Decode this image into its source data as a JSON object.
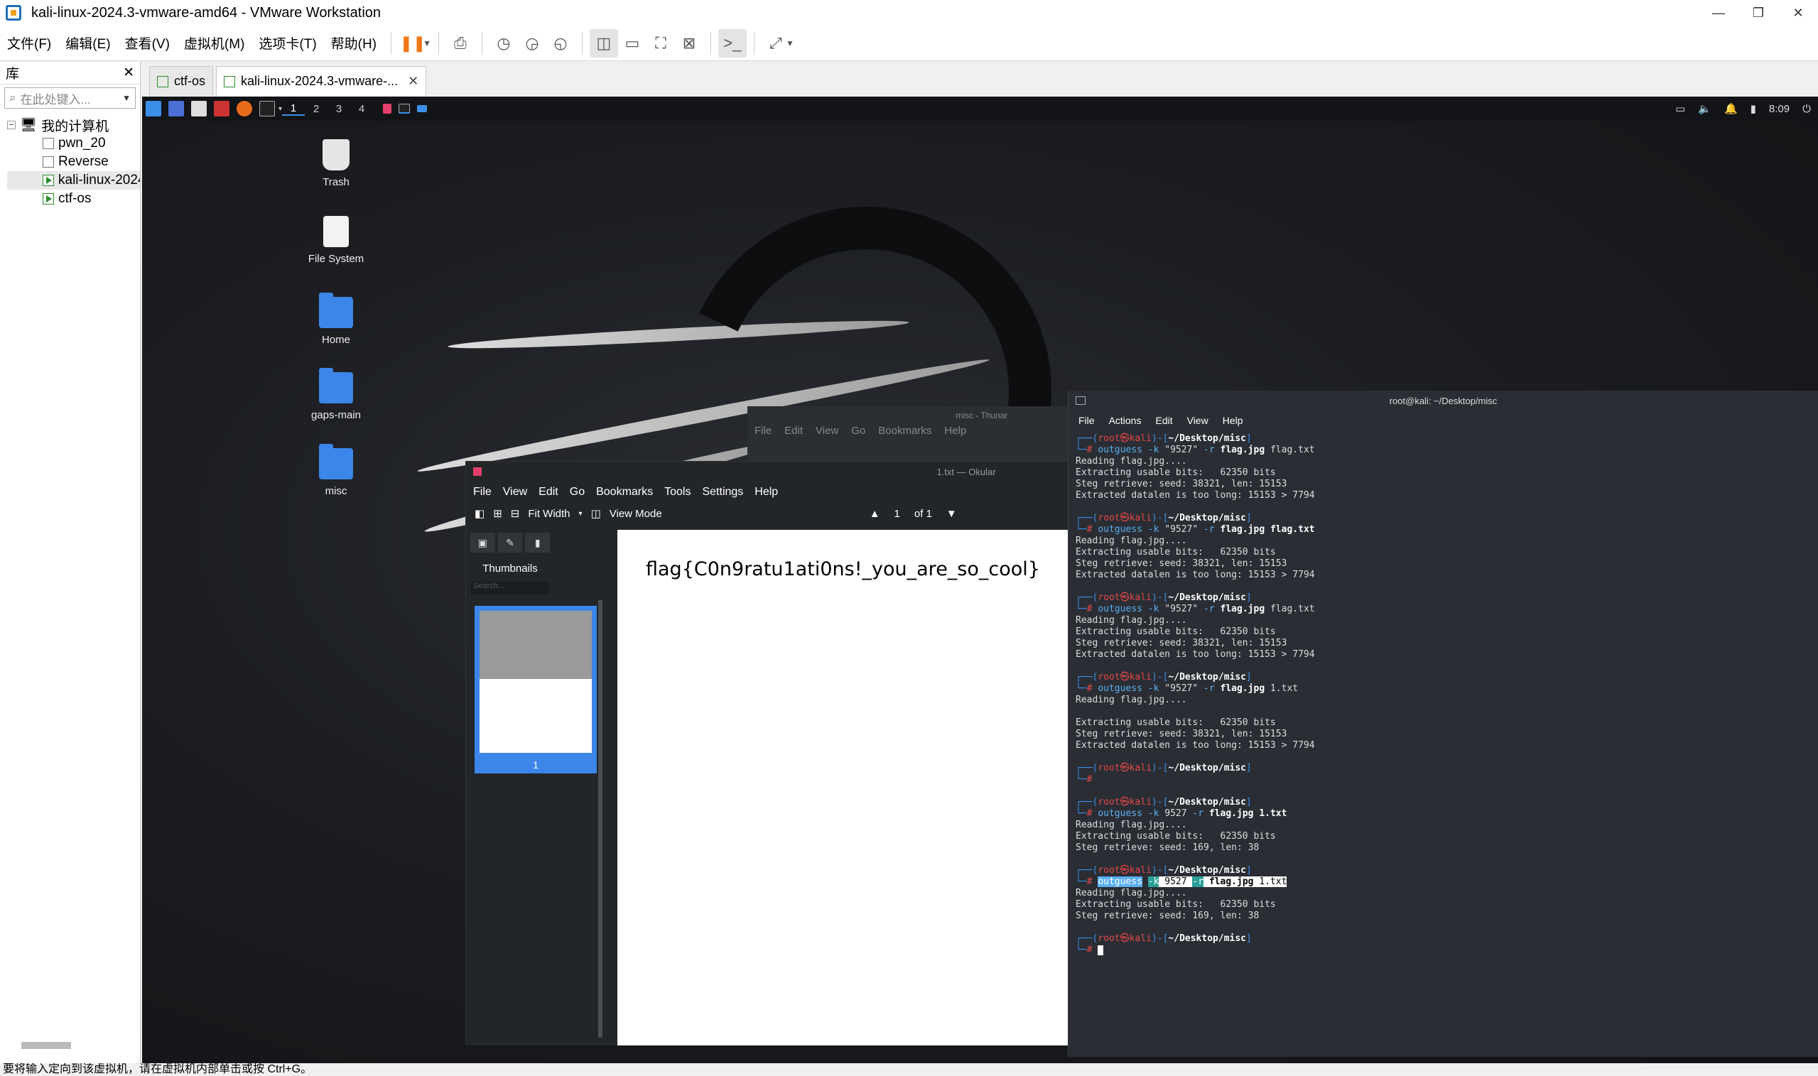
{
  "window": {
    "title": "kali-linux-2024.3-vmware-amd64 - VMware Workstation",
    "controls": [
      "—",
      "❐",
      "✕"
    ]
  },
  "menubar": {
    "items": [
      "文件(F)",
      "编辑(E)",
      "查看(V)",
      "虚拟机(M)",
      "选项卡(T)",
      "帮助(H)"
    ]
  },
  "library": {
    "title": "库",
    "close": "✕",
    "search_placeholder": "在此处键入...",
    "root": "我的计算机",
    "vms": [
      "pwn_20",
      "Reverse",
      "kali-linux-2024.3-vmware-amd64",
      "ctf-os"
    ]
  },
  "tabs": [
    {
      "label": "ctf-os",
      "active": false
    },
    {
      "label": "kali-linux-2024.3-vmware-...",
      "active": true
    }
  ],
  "statusbar": {
    "text": "要将输入定向到该虚拟机，请在虚拟机内部单击或按 Ctrl+G。"
  },
  "panel": {
    "workspaces": [
      "1",
      "2",
      "3",
      "4"
    ],
    "clock": "8:09"
  },
  "desktop": {
    "icons": [
      "Trash",
      "File System",
      "Home",
      "gaps-main",
      "misc"
    ]
  },
  "thunar": {
    "title": "misc - Thunar",
    "menu": [
      "File",
      "Edit",
      "View",
      "Go",
      "Bookmarks",
      "Help"
    ]
  },
  "okular": {
    "title": "1.txt — Okular",
    "menu": [
      "File",
      "View",
      "Edit",
      "Go",
      "Bookmarks",
      "Tools",
      "Settings",
      "Help"
    ],
    "toolbar": {
      "fit": "Fit Width",
      "view_mode": "View Mode",
      "page": "1",
      "of": "of",
      "total": "1"
    },
    "sidebar": {
      "thumbnails_label": "Thumbnails",
      "search_placeholder": "Search...",
      "thumb_number": "1"
    },
    "document_text": "flag{C0n9ratu1ati0ns!_you_are_so_cool}"
  },
  "terminal": {
    "title": "root@kali: ~/Desktop/misc",
    "menu": [
      "File",
      "Actions",
      "Edit",
      "View",
      "Help"
    ],
    "prompt_user": "root",
    "prompt_host": "kali",
    "prompt_dir": "~/Desktop/misc",
    "blocks": [
      {
        "cmd": "outguess",
        "args": [
          "-k",
          "\"9527\"",
          "-r"
        ],
        "file": "flag.jpg",
        "out": "flag.txt",
        "out_bold": false,
        "output": [
          "Reading flag.jpg....",
          "Extracting usable bits:   62350 bits",
          "Steg retrieve: seed: 38321, len: 15153",
          "Extracted datalen is too long: 15153 > 7794"
        ]
      },
      {
        "cmd": "outguess",
        "args": [
          "-k",
          "\"9527\"",
          "-r"
        ],
        "file": "flag.jpg",
        "out": "flag.txt",
        "out_bold": true,
        "output": [
          "Reading flag.jpg....",
          "Extracting usable bits:   62350 bits",
          "Steg retrieve: seed: 38321, len: 15153",
          "Extracted datalen is too long: 15153 > 7794"
        ]
      },
      {
        "cmd": "outguess",
        "args": [
          "-k",
          "\"9527\"",
          "-r"
        ],
        "file": "flag.jpg",
        "out": "flag.txt",
        "out_bold": false,
        "output": [
          "Reading flag.jpg....",
          "Extracting usable bits:   62350 bits",
          "Steg retrieve: seed: 38321, len: 15153",
          "Extracted datalen is too long: 15153 > 7794"
        ]
      },
      {
        "cmd": "outguess",
        "args": [
          "-k",
          "\"9527\"",
          "-r"
        ],
        "file": "flag.jpg",
        "out": "1.txt",
        "out_bold": false,
        "output": [
          "Reading flag.jpg....",
          "",
          "Extracting usable bits:   62350 bits",
          "Steg retrieve: seed: 38321, len: 15153",
          "Extracted datalen is too long: 15153 > 7794"
        ]
      },
      {
        "cmd": "",
        "args": [],
        "file": "",
        "out": "",
        "out_bold": false,
        "output": [
          ""
        ]
      },
      {
        "cmd": "outguess",
        "args": [
          "-k",
          "9527",
          "-r"
        ],
        "file": "flag.jpg",
        "out": "1.txt",
        "out_bold": true,
        "output": [
          "Reading flag.jpg....",
          "Extracting usable bits:   62350 bits",
          "Steg retrieve: seed: 169, len: 38"
        ]
      },
      {
        "cmd": "outguess",
        "args": [
          "-k",
          "9527",
          "-r"
        ],
        "file": "flag.jpg",
        "out": "1.txt",
        "out_bold": false,
        "highlighted": true,
        "output": [
          "Reading flag.jpg....",
          "Extracting usable bits:   62350 bits",
          "Steg retrieve: seed: 169, len: 38"
        ]
      }
    ]
  }
}
